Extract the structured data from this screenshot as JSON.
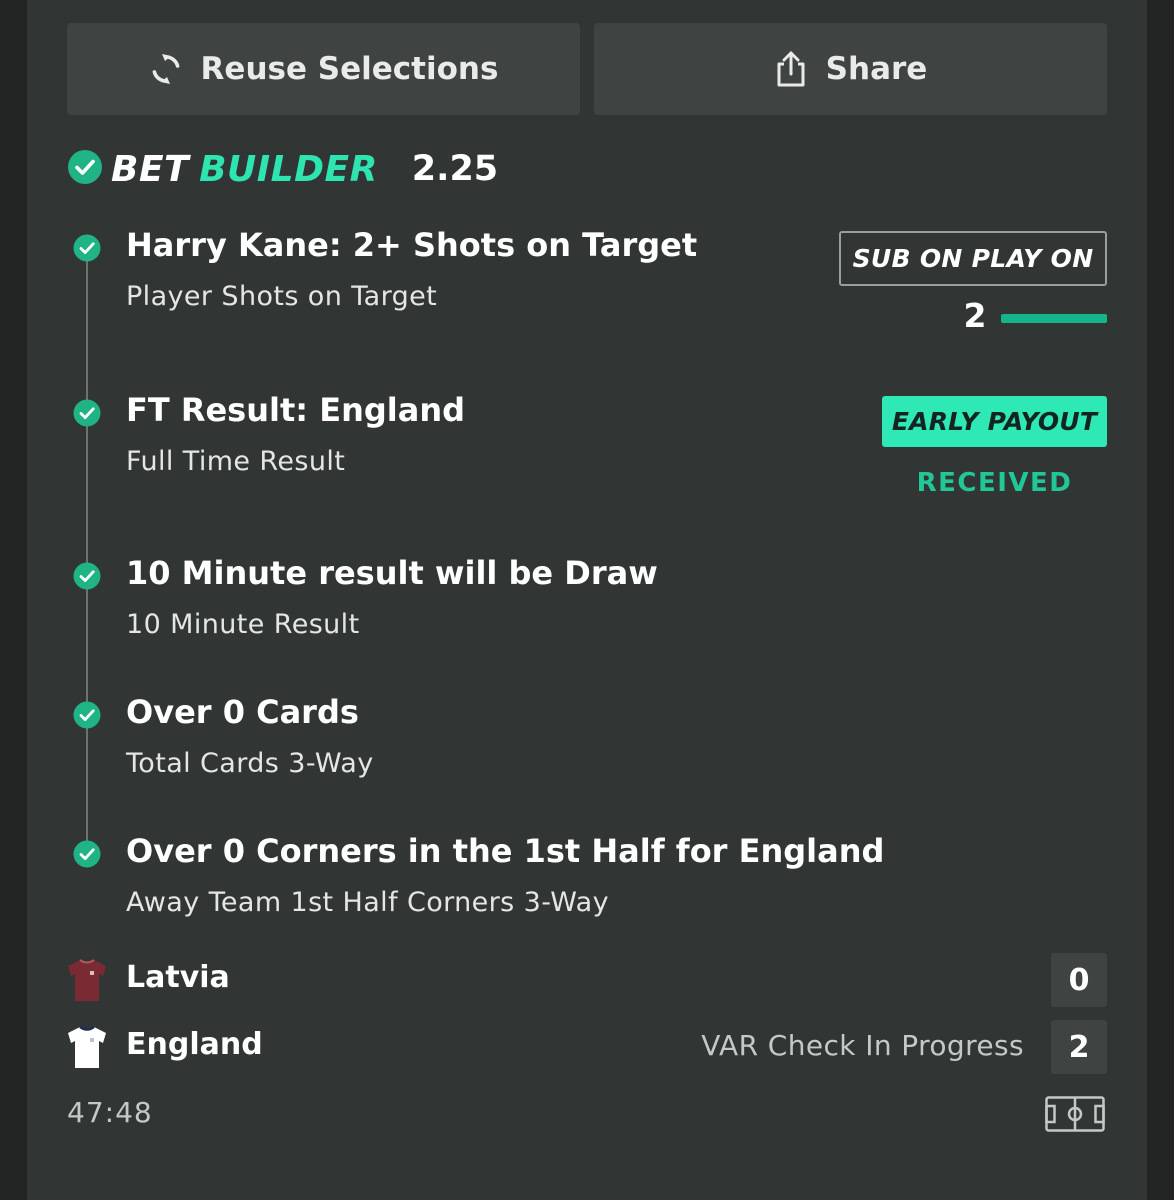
{
  "toolbar": {
    "reuse_label": "Reuse Selections",
    "share_label": "Share"
  },
  "bet_builder": {
    "title_part1": "BET",
    "title_part2": "BUILDER",
    "odds": "2.25"
  },
  "selections": [
    {
      "title": "Harry Kane: 2+ Shots on Target",
      "market": "Player Shots on Target"
    },
    {
      "title": "FT Result: England",
      "market": "Full Time Result"
    },
    {
      "title": "10 Minute result will be Draw",
      "market": "10 Minute Result"
    },
    {
      "title": "Over 0 Cards",
      "market": "Total Cards 3-Way"
    },
    {
      "title": "Over 0 Corners in the 1st Half for England",
      "market": "Away Team 1st Half Corners 3-Way"
    }
  ],
  "badges": {
    "sub_on_play_on": "SUB ON PLAY ON",
    "shots_progress_value": "2",
    "shots_progress_fraction": 1.0,
    "early_payout": "EARLY PAYOUT",
    "received": "RECEIVED"
  },
  "match": {
    "home_team": "Latvia",
    "home_score": "0",
    "away_team": "England",
    "away_score": "2",
    "status": "VAR Check In Progress",
    "clock": "47:48"
  },
  "colors": {
    "accent_green": "#2ee4b0",
    "check_green": "#1fb386",
    "card_background": "#313534",
    "button_background": "#3f4342",
    "latvia_shirt": "#7a2a33",
    "england_shirt": "#ffffff"
  },
  "icons": {
    "reuse": "refresh-icon",
    "share": "share-icon",
    "check": "check-circle-icon",
    "home_shirt": "shirt-icon",
    "away_shirt": "shirt-icon",
    "pitch": "pitch-icon"
  }
}
